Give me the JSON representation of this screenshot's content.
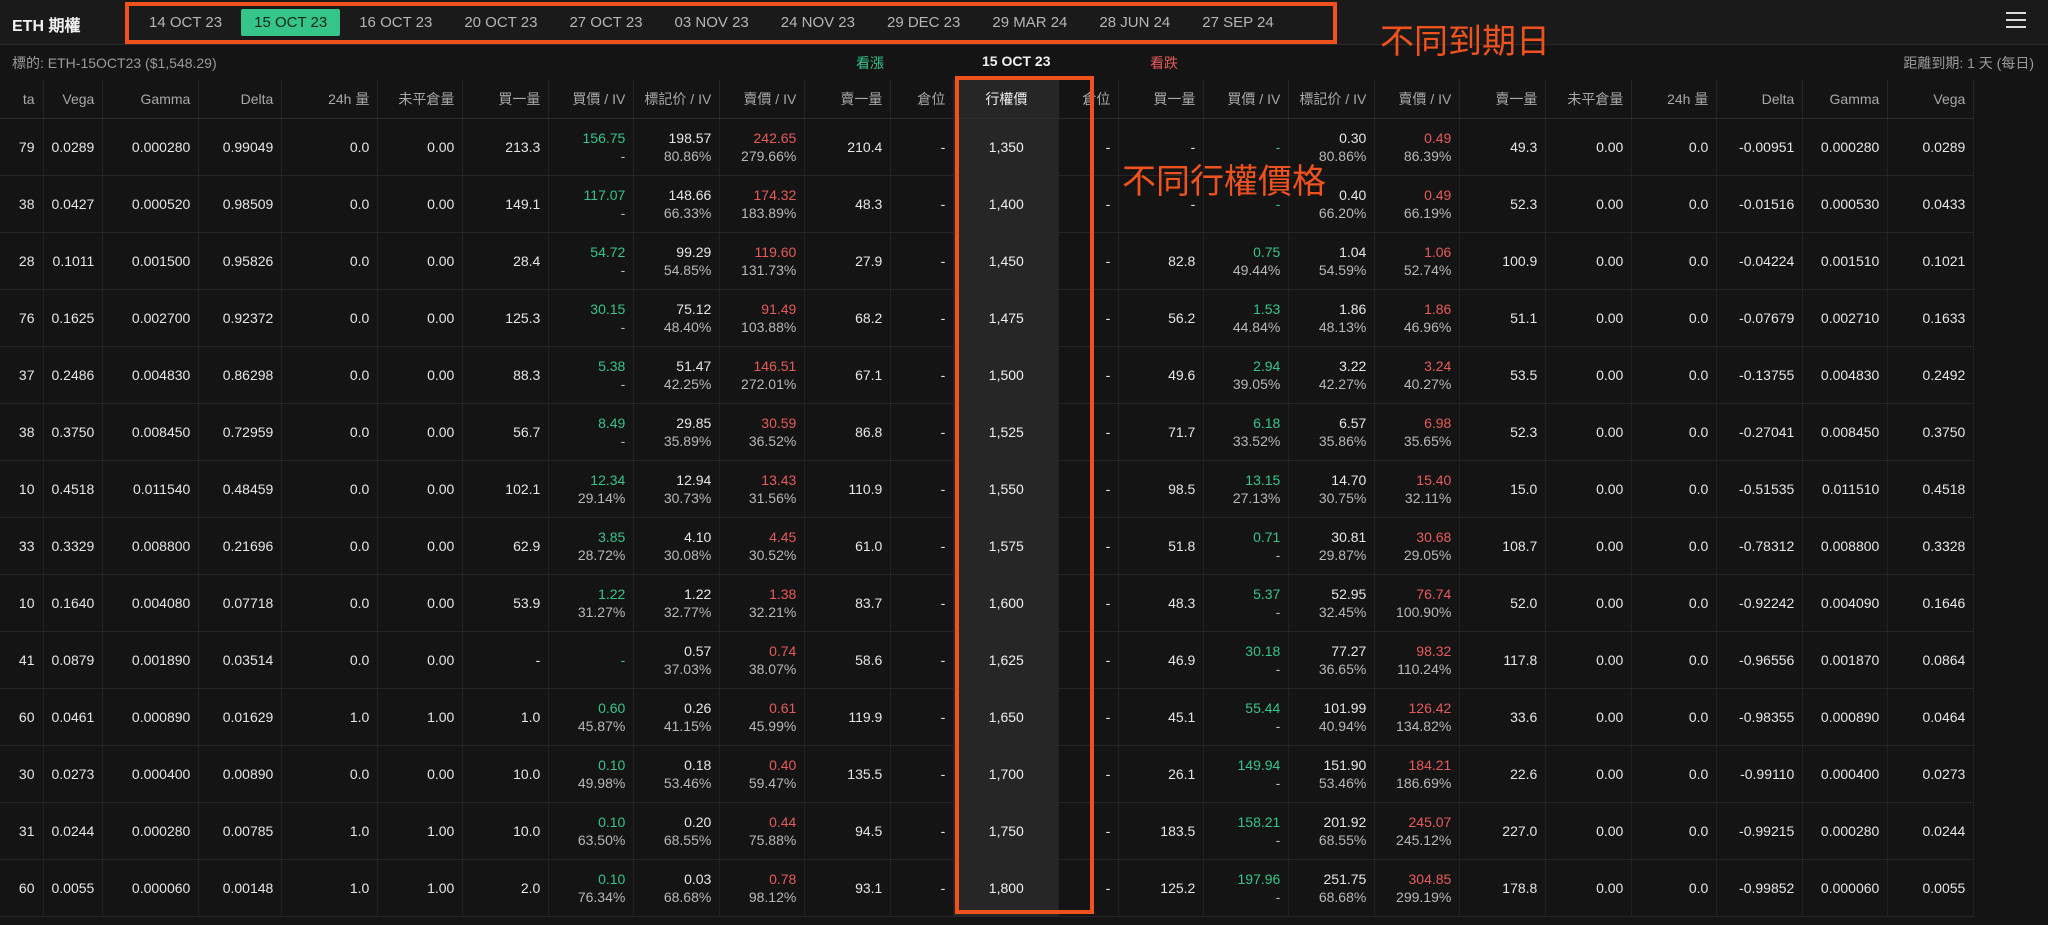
{
  "app": {
    "title": "ETH 期權"
  },
  "expiry_tabs": [
    "14 OCT 23",
    "15 OCT 23",
    "16 OCT 23",
    "20 OCT 23",
    "27 OCT 23",
    "03 NOV 23",
    "24 NOV 23",
    "29 DEC 23",
    "29 MAR 24",
    "28 JUN 24",
    "27 SEP 24"
  ],
  "active_expiry_index": 1,
  "annotations": {
    "dates": "不同到期日",
    "strikes": "不同行權價格",
    "color": "#f0521d"
  },
  "info_bar": {
    "underlying": "標的: ETH-15OCT23 ($1,548.29)",
    "calls_label": "看漲",
    "expiry": "15 OCT 23",
    "puts_label": "看跌",
    "time_to_expiry": "距離到期: 1 天 (每日)"
  },
  "colors": {
    "accent_green": "#35c48a",
    "accent_red": "#e85a5a",
    "background": "#141414"
  },
  "headers": [
    "ta",
    "Vega",
    "Gamma",
    "Delta",
    "24h 量",
    "未平倉量",
    "買一量",
    "買價 / IV",
    "標記价 / IV",
    "賣價 / IV",
    "賣一量",
    "倉位",
    "行權價",
    "倉位",
    "買一量",
    "買價 / IV",
    "標記价 / IV",
    "賣價 / IV",
    "賣一量",
    "未平倉量",
    "24h 量",
    "Delta",
    "Gamma",
    "Vega"
  ],
  "rows": [
    {
      "strike": "1,350",
      "call": {
        "lead": "79",
        "vega": "0.0289",
        "gamma": "0.000280",
        "delta": "0.99049",
        "vol24h": "0.0",
        "oi": "0.00",
        "bid_size": "213.3",
        "bid": "156.75",
        "bid_iv": "-",
        "mark": "198.57",
        "mark_iv": "80.86%",
        "ask": "242.65",
        "ask_iv": "279.66%",
        "ask_size": "210.4",
        "pos": "-"
      },
      "put": {
        "pos": "-",
        "bid_size": "-",
        "bid": "-",
        "bid_iv": "",
        "mark": "0.30",
        "mark_iv": "80.86%",
        "ask": "0.49",
        "ask_iv": "86.39%",
        "ask_size": "49.3",
        "oi": "0.00",
        "vol24h": "0.0",
        "delta": "-0.00951",
        "gamma": "0.000280",
        "vega": "0.0289"
      }
    },
    {
      "strike": "1,400",
      "call": {
        "lead": "38",
        "vega": "0.0427",
        "gamma": "0.000520",
        "delta": "0.98509",
        "vol24h": "0.0",
        "oi": "0.00",
        "bid_size": "149.1",
        "bid": "117.07",
        "bid_iv": "-",
        "mark": "148.66",
        "mark_iv": "66.33%",
        "ask": "174.32",
        "ask_iv": "183.89%",
        "ask_size": "48.3",
        "pos": "-"
      },
      "put": {
        "pos": "-",
        "bid_size": "-",
        "bid": "-",
        "bid_iv": "",
        "mark": "0.40",
        "mark_iv": "66.20%",
        "ask": "0.49",
        "ask_iv": "66.19%",
        "ask_size": "52.3",
        "oi": "0.00",
        "vol24h": "0.0",
        "delta": "-0.01516",
        "gamma": "0.000530",
        "vega": "0.0433"
      }
    },
    {
      "strike": "1,450",
      "call": {
        "lead": "28",
        "vega": "0.1011",
        "gamma": "0.001500",
        "delta": "0.95826",
        "vol24h": "0.0",
        "oi": "0.00",
        "bid_size": "28.4",
        "bid": "54.72",
        "bid_iv": "-",
        "mark": "99.29",
        "mark_iv": "54.85%",
        "ask": "119.60",
        "ask_iv": "131.73%",
        "ask_size": "27.9",
        "pos": "-"
      },
      "put": {
        "pos": "-",
        "bid_size": "82.8",
        "bid": "0.75",
        "bid_iv": "49.44%",
        "mark": "1.04",
        "mark_iv": "54.59%",
        "ask": "1.06",
        "ask_iv": "52.74%",
        "ask_size": "100.9",
        "oi": "0.00",
        "vol24h": "0.0",
        "delta": "-0.04224",
        "gamma": "0.001510",
        "vega": "0.1021"
      }
    },
    {
      "strike": "1,475",
      "call": {
        "lead": "76",
        "vega": "0.1625",
        "gamma": "0.002700",
        "delta": "0.92372",
        "vol24h": "0.0",
        "oi": "0.00",
        "bid_size": "125.3",
        "bid": "30.15",
        "bid_iv": "-",
        "mark": "75.12",
        "mark_iv": "48.40%",
        "ask": "91.49",
        "ask_iv": "103.88%",
        "ask_size": "68.2",
        "pos": "-"
      },
      "put": {
        "pos": "-",
        "bid_size": "56.2",
        "bid": "1.53",
        "bid_iv": "44.84%",
        "mark": "1.86",
        "mark_iv": "48.13%",
        "ask": "1.86",
        "ask_iv": "46.96%",
        "ask_size": "51.1",
        "oi": "0.00",
        "vol24h": "0.0",
        "delta": "-0.07679",
        "gamma": "0.002710",
        "vega": "0.1633"
      }
    },
    {
      "strike": "1,500",
      "call": {
        "lead": "37",
        "vega": "0.2486",
        "gamma": "0.004830",
        "delta": "0.86298",
        "vol24h": "0.0",
        "oi": "0.00",
        "bid_size": "88.3",
        "bid": "5.38",
        "bid_iv": "-",
        "mark": "51.47",
        "mark_iv": "42.25%",
        "ask": "146.51",
        "ask_iv": "272.01%",
        "ask_size": "67.1",
        "pos": "-"
      },
      "put": {
        "pos": "-",
        "bid_size": "49.6",
        "bid": "2.94",
        "bid_iv": "39.05%",
        "mark": "3.22",
        "mark_iv": "42.27%",
        "ask": "3.24",
        "ask_iv": "40.27%",
        "ask_size": "53.5",
        "oi": "0.00",
        "vol24h": "0.0",
        "delta": "-0.13755",
        "gamma": "0.004830",
        "vega": "0.2492"
      }
    },
    {
      "strike": "1,525",
      "call": {
        "lead": "38",
        "vega": "0.3750",
        "gamma": "0.008450",
        "delta": "0.72959",
        "vol24h": "0.0",
        "oi": "0.00",
        "bid_size": "56.7",
        "bid": "8.49",
        "bid_iv": "-",
        "mark": "29.85",
        "mark_iv": "35.89%",
        "ask": "30.59",
        "ask_iv": "36.52%",
        "ask_size": "86.8",
        "pos": "-"
      },
      "put": {
        "pos": "-",
        "bid_size": "71.7",
        "bid": "6.18",
        "bid_iv": "33.52%",
        "mark": "6.57",
        "mark_iv": "35.86%",
        "ask": "6.98",
        "ask_iv": "35.65%",
        "ask_size": "52.3",
        "oi": "0.00",
        "vol24h": "0.0",
        "delta": "-0.27041",
        "gamma": "0.008450",
        "vega": "0.3750"
      }
    },
    {
      "strike": "1,550",
      "call": {
        "lead": "10",
        "vega": "0.4518",
        "gamma": "0.011540",
        "delta": "0.48459",
        "vol24h": "0.0",
        "oi": "0.00",
        "bid_size": "102.1",
        "bid": "12.34",
        "bid_iv": "29.14%",
        "mark": "12.94",
        "mark_iv": "30.73%",
        "ask": "13.43",
        "ask_iv": "31.56%",
        "ask_size": "110.9",
        "pos": "-"
      },
      "put": {
        "pos": "-",
        "bid_size": "98.5",
        "bid": "13.15",
        "bid_iv": "27.13%",
        "mark": "14.70",
        "mark_iv": "30.75%",
        "ask": "15.40",
        "ask_iv": "32.11%",
        "ask_size": "15.0",
        "oi": "0.00",
        "vol24h": "0.0",
        "delta": "-0.51535",
        "gamma": "0.011510",
        "vega": "0.4518"
      }
    },
    {
      "strike": "1,575",
      "call": {
        "lead": "33",
        "vega": "0.3329",
        "gamma": "0.008800",
        "delta": "0.21696",
        "vol24h": "0.0",
        "oi": "0.00",
        "bid_size": "62.9",
        "bid": "3.85",
        "bid_iv": "28.72%",
        "mark": "4.10",
        "mark_iv": "30.08%",
        "ask": "4.45",
        "ask_iv": "30.52%",
        "ask_size": "61.0",
        "pos": "-"
      },
      "put": {
        "pos": "-",
        "bid_size": "51.8",
        "bid": "0.71",
        "bid_iv": "-",
        "mark": "30.81",
        "mark_iv": "29.87%",
        "ask": "30.68",
        "ask_iv": "29.05%",
        "ask_size": "108.7",
        "oi": "0.00",
        "vol24h": "0.0",
        "delta": "-0.78312",
        "gamma": "0.008800",
        "vega": "0.3328"
      }
    },
    {
      "strike": "1,600",
      "call": {
        "lead": "10",
        "vega": "0.1640",
        "gamma": "0.004080",
        "delta": "0.07718",
        "vol24h": "0.0",
        "oi": "0.00",
        "bid_size": "53.9",
        "bid": "1.22",
        "bid_iv": "31.27%",
        "mark": "1.22",
        "mark_iv": "32.77%",
        "ask": "1.38",
        "ask_iv": "32.21%",
        "ask_size": "83.7",
        "pos": "-"
      },
      "put": {
        "pos": "-",
        "bid_size": "48.3",
        "bid": "5.37",
        "bid_iv": "-",
        "mark": "52.95",
        "mark_iv": "32.45%",
        "ask": "76.74",
        "ask_iv": "100.90%",
        "ask_size": "52.0",
        "oi": "0.00",
        "vol24h": "0.0",
        "delta": "-0.92242",
        "gamma": "0.004090",
        "vega": "0.1646"
      }
    },
    {
      "strike": "1,625",
      "call": {
        "lead": "41",
        "vega": "0.0879",
        "gamma": "0.001890",
        "delta": "0.03514",
        "vol24h": "0.0",
        "oi": "0.00",
        "bid_size": "-",
        "bid": "-",
        "bid_iv": "",
        "mark": "0.57",
        "mark_iv": "37.03%",
        "ask": "0.74",
        "ask_iv": "38.07%",
        "ask_size": "58.6",
        "pos": "-"
      },
      "put": {
        "pos": "-",
        "bid_size": "46.9",
        "bid": "30.18",
        "bid_iv": "-",
        "mark": "77.27",
        "mark_iv": "36.65%",
        "ask": "98.32",
        "ask_iv": "110.24%",
        "ask_size": "117.8",
        "oi": "0.00",
        "vol24h": "0.0",
        "delta": "-0.96556",
        "gamma": "0.001870",
        "vega": "0.0864"
      }
    },
    {
      "strike": "1,650",
      "call": {
        "lead": "60",
        "vega": "0.0461",
        "gamma": "0.000890",
        "delta": "0.01629",
        "vol24h": "1.0",
        "oi": "1.00",
        "bid_size": "1.0",
        "bid": "0.60",
        "bid_iv": "45.87%",
        "mark": "0.26",
        "mark_iv": "41.15%",
        "ask": "0.61",
        "ask_iv": "45.99%",
        "ask_size": "119.9",
        "pos": "-"
      },
      "put": {
        "pos": "-",
        "bid_size": "45.1",
        "bid": "55.44",
        "bid_iv": "-",
        "mark": "101.99",
        "mark_iv": "40.94%",
        "ask": "126.42",
        "ask_iv": "134.82%",
        "ask_size": "33.6",
        "oi": "0.00",
        "vol24h": "0.0",
        "delta": "-0.98355",
        "gamma": "0.000890",
        "vega": "0.0464"
      }
    },
    {
      "strike": "1,700",
      "call": {
        "lead": "30",
        "vega": "0.0273",
        "gamma": "0.000400",
        "delta": "0.00890",
        "vol24h": "0.0",
        "oi": "0.00",
        "bid_size": "10.0",
        "bid": "0.10",
        "bid_iv": "49.98%",
        "mark": "0.18",
        "mark_iv": "53.46%",
        "ask": "0.40",
        "ask_iv": "59.47%",
        "ask_size": "135.5",
        "pos": "-"
      },
      "put": {
        "pos": "-",
        "bid_size": "26.1",
        "bid": "149.94",
        "bid_iv": "-",
        "mark": "151.90",
        "mark_iv": "53.46%",
        "ask": "184.21",
        "ask_iv": "186.69%",
        "ask_size": "22.6",
        "oi": "0.00",
        "vol24h": "0.0",
        "delta": "-0.99110",
        "gamma": "0.000400",
        "vega": "0.0273"
      }
    },
    {
      "strike": "1,750",
      "call": {
        "lead": "31",
        "vega": "0.0244",
        "gamma": "0.000280",
        "delta": "0.00785",
        "vol24h": "1.0",
        "oi": "1.00",
        "bid_size": "10.0",
        "bid": "0.10",
        "bid_iv": "63.50%",
        "mark": "0.20",
        "mark_iv": "68.55%",
        "ask": "0.44",
        "ask_iv": "75.88%",
        "ask_size": "94.5",
        "pos": "-"
      },
      "put": {
        "pos": "-",
        "bid_size": "183.5",
        "bid": "158.21",
        "bid_iv": "-",
        "mark": "201.92",
        "mark_iv": "68.55%",
        "ask": "245.07",
        "ask_iv": "245.12%",
        "ask_size": "227.0",
        "oi": "0.00",
        "vol24h": "0.0",
        "delta": "-0.99215",
        "gamma": "0.000280",
        "vega": "0.0244"
      }
    },
    {
      "strike": "1,800",
      "call": {
        "lead": "60",
        "vega": "0.0055",
        "gamma": "0.000060",
        "delta": "0.00148",
        "vol24h": "1.0",
        "oi": "1.00",
        "bid_size": "2.0",
        "bid": "0.10",
        "bid_iv": "76.34%",
        "mark": "0.03",
        "mark_iv": "68.68%",
        "ask": "0.78",
        "ask_iv": "98.12%",
        "ask_size": "93.1",
        "pos": "-"
      },
      "put": {
        "pos": "-",
        "bid_size": "125.2",
        "bid": "197.96",
        "bid_iv": "-",
        "mark": "251.75",
        "mark_iv": "68.68%",
        "ask": "304.85",
        "ask_iv": "299.19%",
        "ask_size": "178.8",
        "oi": "0.00",
        "vol24h": "0.0",
        "delta": "-0.99852",
        "gamma": "0.000060",
        "vega": "0.0055"
      }
    }
  ]
}
